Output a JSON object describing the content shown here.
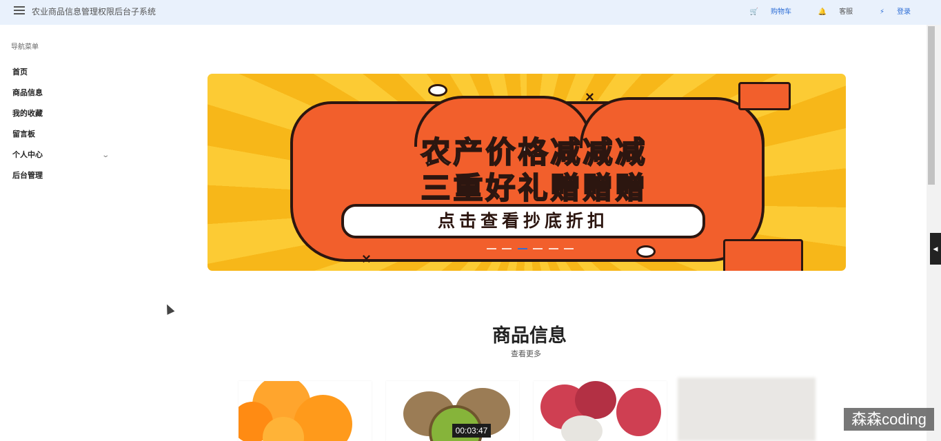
{
  "header": {
    "title": "农业商品信息管理权限后台子系统",
    "actions": {
      "cart": "购物车",
      "service": "客服",
      "login": "登录"
    },
    "colors": {
      "background": "#e9f1fc",
      "accent": "#2f6fd6"
    }
  },
  "sidebar": {
    "title": "导航菜单",
    "items": [
      {
        "label": "首页"
      },
      {
        "label": "商品信息"
      },
      {
        "label": "我的收藏"
      },
      {
        "label": "留言板"
      },
      {
        "label": "个人中心",
        "expandable": true
      },
      {
        "label": "后台管理"
      }
    ]
  },
  "banner": {
    "line1_white": "农产价格",
    "line1_yellow": "减减减",
    "line2_yellow": "三重好礼",
    "line2_white": "赠赠赠",
    "cta": "点击查看抄底折扣",
    "slides_total": 6,
    "active_slide": 3
  },
  "products_section": {
    "title": "商品信息",
    "more": "查看更多",
    "items": [
      {
        "image": "orange-image"
      },
      {
        "image": "kiwi-image"
      },
      {
        "image": "lychee-image"
      },
      {
        "image": "blurred-product-image"
      }
    ]
  },
  "overlay": {
    "timestamp": "00:03:47",
    "watermark": "森森coding"
  }
}
